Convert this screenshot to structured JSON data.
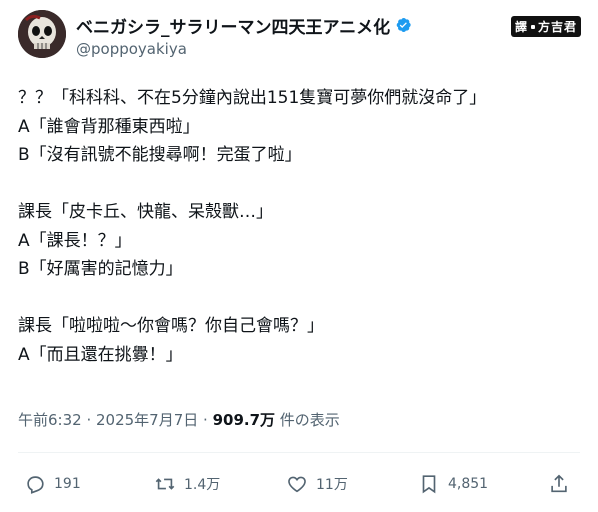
{
  "author": {
    "display_name": "ベニガシラ_サラリーマン四天王アニメ化",
    "handle": "@poppoyakiya",
    "verified": true
  },
  "badge": {
    "left": "譯",
    "right": "方吉君"
  },
  "tweet_lines": [
    "？？「科科科、不在5分鐘內說出151隻寶可夢你們就沒命了」",
    "A「誰會背那種東西啦」",
    "B「沒有訊號不能搜尋啊！完蛋了啦」",
    "",
    "課長「皮卡丘、快龍、呆殼獸…」",
    "A「課長！？」",
    "B「好厲害的記憶力」",
    "",
    "課長「啦啦啦～你會嗎？你自己會嗎？」",
    "A「而且還在挑釁！」"
  ],
  "meta": {
    "time": "午前6:32",
    "sep1": " · ",
    "date": "2025年7月7日",
    "sep2": " · ",
    "views_count": "909.7万",
    "views_label": " 件の表示"
  },
  "actions": {
    "replies": "191",
    "reposts": "1.4万",
    "likes": "11万",
    "bookmarks": "4,851"
  },
  "colors": {
    "text": "#0f1419",
    "secondary": "#536471",
    "verified": "#1d9bf0"
  },
  "icons": [
    "avatar-skull",
    "verified-badge-icon",
    "reply-icon",
    "repost-icon",
    "like-icon",
    "bookmark-icon",
    "share-icon"
  ]
}
